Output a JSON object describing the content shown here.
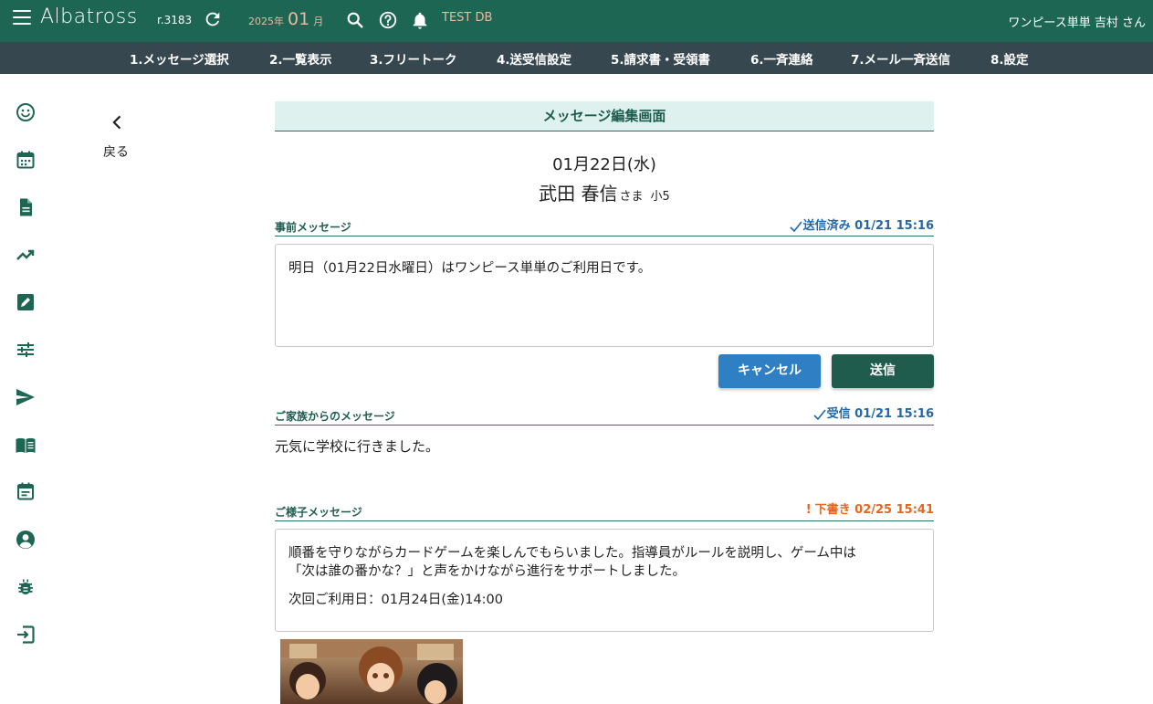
{
  "topbar": {
    "logo": "Albatross",
    "revision": "r.3183",
    "year_label": "2025年",
    "month_value": "01",
    "month_suffix": "月",
    "db_label": "TEST DB",
    "user_label": "ワンピース単単 吉村 さん",
    "icons": [
      "menu-icon",
      "reload-icon",
      "search-icon",
      "help-icon",
      "bell-icon"
    ]
  },
  "nav": {
    "items": [
      "1.メッセージ選択",
      "2.一覧表示",
      "3.フリートーク",
      "4.送受信設定",
      "5.請求書・受領書",
      "6.一斉連絡",
      "7.メール一斉送信",
      "8.設定"
    ]
  },
  "sidebar": {
    "icons": [
      "smile-icon",
      "calendar-icon",
      "document-icon",
      "trending-icon",
      "edit-icon",
      "sliders-icon",
      "send-icon",
      "book-icon",
      "event-icon",
      "account-icon",
      "bug-icon",
      "logout-icon"
    ]
  },
  "back": {
    "label": "戻る"
  },
  "page": {
    "title": "メッセージ編集画面",
    "date": "01月22日(水)",
    "name": "武田 春信",
    "honorific": "さま",
    "grade": "小5"
  },
  "advance_message": {
    "title": "事前メッセージ",
    "status": "送信済み 01/21 15:16",
    "body": "明日（01月22日水曜日）はワンピース単単のご利用日です。"
  },
  "buttons": {
    "cancel": "キャンセル",
    "send": "送信"
  },
  "family_message": {
    "title": "ご家族からのメッセージ",
    "status": "受信 01/21 15:16",
    "body": "元気に学校に行きました。"
  },
  "status_message": {
    "title": "ご様子メッセージ",
    "status": "下書き 02/25 15:41",
    "line1": "順番を守りながらカードゲームを楽しんでもらいました。指導員がルールを説明し、ゲーム中は",
    "line2": "「次は誰の番かな？」と声をかけながら進行をサポートしました。",
    "line3": "次回ご利用日：01月24日(金)14:00"
  },
  "colors": {
    "topbar": "#1e6654",
    "navbar": "#37474f",
    "accent_teal": "#1e5c50",
    "status_blue": "#2468a8",
    "status_orange": "#e5661e",
    "cancel_button": "#2f7fc4",
    "send_button": "#1f5c4e"
  }
}
